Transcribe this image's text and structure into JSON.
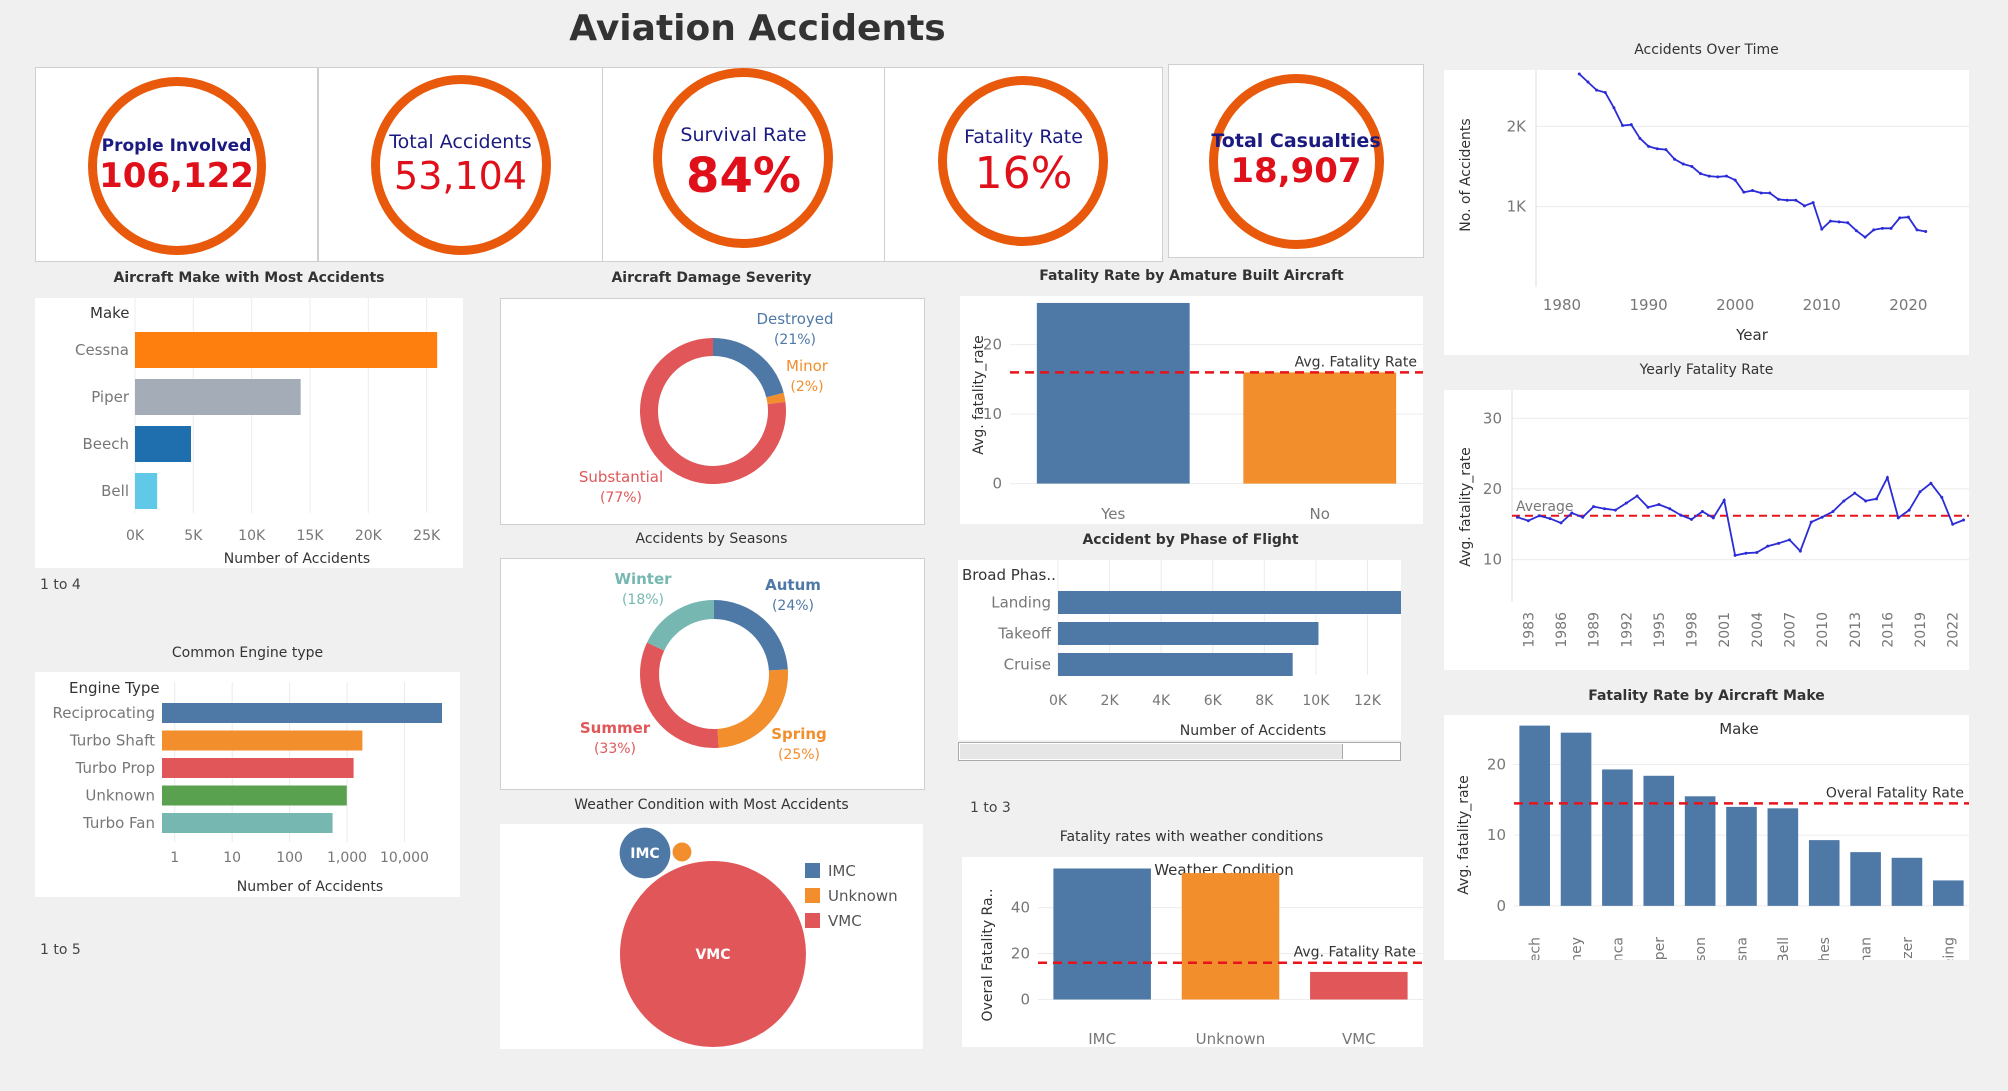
{
  "page_title": "Aviation Accidents",
  "kpis": [
    {
      "label": "Prople Involved",
      "value": "106,122"
    },
    {
      "label": "Total Accidents",
      "value": "53,104"
    },
    {
      "label": "Survival Rate",
      "value": "84%"
    },
    {
      "label": "Fatality Rate",
      "value": "16%"
    },
    {
      "label": "Total Casualties",
      "value": "18,907"
    }
  ],
  "pagers": {
    "make": "1 to 4",
    "engine": "1 to 5",
    "phase": "1 to 3"
  },
  "colors": {
    "kpi_ring": "#e8590c",
    "kpi_value": "#e0101a",
    "kpi_label": "#1a1a80",
    "bar_blue": "#4e79a7",
    "bar_orange": "#f28e2b",
    "ref_line": "#e8141c"
  },
  "chart_data": [
    {
      "id": "make",
      "type": "bar",
      "orientation": "horizontal",
      "title": "Aircraft Make with Most Accidents",
      "header": "Make",
      "xlabel": "Number of Accidents",
      "categories": [
        "Cessna",
        "Piper",
        "Beech",
        "Bell"
      ],
      "values": [
        25900,
        14200,
        4800,
        1900
      ],
      "colors": [
        "#ff7f0e",
        "#a4acb8",
        "#1f6ead",
        "#62c8e8"
      ],
      "xlim": [
        0,
        27000
      ],
      "xticks": [
        0,
        5000,
        10000,
        15000,
        20000,
        25000
      ],
      "xtick_labels": [
        "0K",
        "5K",
        "10K",
        "15K",
        "20K",
        "25K"
      ]
    },
    {
      "id": "damage",
      "type": "pie",
      "subtype": "donut",
      "title": "Aircraft Damage Severity",
      "slices": [
        {
          "label": "Destroyed",
          "pct_label": "(21%)",
          "value": 21,
          "color": "#4e79a7"
        },
        {
          "label": "Minor",
          "pct_label": "(2%)",
          "value": 2,
          "color": "#f28e2b"
        },
        {
          "label": "Substantial",
          "pct_label": "(77%)",
          "value": 77,
          "color": "#e15759"
        }
      ]
    },
    {
      "id": "amateur",
      "type": "bar",
      "title": "Fatality Rate by Amature Built Aircraft",
      "ylabel": "Avg. fatality_rate",
      "categories": [
        "Yes",
        "No"
      ],
      "values": [
        26,
        16
      ],
      "colors": [
        "#4e79a7",
        "#f28e2b"
      ],
      "ylim": [
        -1.5,
        27
      ],
      "yticks": [
        0,
        10,
        20
      ],
      "reference_line": {
        "label": "Avg.  Fatality Rate",
        "value": 16
      }
    },
    {
      "id": "time",
      "type": "line",
      "title": "Accidents Over Time",
      "xlabel": "Year",
      "ylabel": "No. of Accidents",
      "color": "#2c2cd6",
      "x": [
        1982,
        1983,
        1984,
        1985,
        1986,
        1987,
        1988,
        1989,
        1990,
        1991,
        1992,
        1993,
        1994,
        1995,
        1996,
        1997,
        1998,
        1999,
        2000,
        2001,
        2002,
        2003,
        2004,
        2005,
        2006,
        2007,
        2008,
        2009,
        2010,
        2011,
        2012,
        2013,
        2014,
        2015,
        2016,
        2017,
        2018,
        2019,
        2020,
        2021,
        2022
      ],
      "values": [
        2650,
        2550,
        2450,
        2420,
        2230,
        2010,
        2020,
        1850,
        1750,
        1720,
        1710,
        1590,
        1530,
        1500,
        1410,
        1380,
        1370,
        1380,
        1330,
        1180,
        1200,
        1170,
        1170,
        1090,
        1080,
        1080,
        1010,
        1050,
        720,
        820,
        810,
        800,
        700,
        620,
        710,
        730,
        730,
        860,
        870,
        710,
        690
      ],
      "xlim": [
        1977,
        2027
      ],
      "ylim": [
        0,
        2700
      ],
      "xticks": [
        1980,
        1990,
        2000,
        2010,
        2020
      ],
      "yticks": [
        1000,
        2000
      ],
      "ytick_labels": [
        "1K",
        "2K"
      ]
    },
    {
      "id": "yearly",
      "type": "line",
      "title": "Yearly Fatality Rate",
      "ylabel": "Avg. fatality_rate",
      "color": "#2c2cd6",
      "x": [
        1982,
        1983,
        1984,
        1985,
        1986,
        1987,
        1988,
        1989,
        1990,
        1991,
        1992,
        1993,
        1994,
        1995,
        1996,
        1997,
        1998,
        1999,
        2000,
        2001,
        2002,
        2003,
        2004,
        2005,
        2006,
        2007,
        2008,
        2009,
        2010,
        2011,
        2012,
        2013,
        2014,
        2015,
        2016,
        2017,
        2018,
        2019,
        2020,
        2021,
        2022,
        2023
      ],
      "values": [
        16,
        15.5,
        16.2,
        15.8,
        15.2,
        16.6,
        16,
        17.5,
        17.2,
        17,
        18,
        19,
        17.4,
        17.8,
        17.2,
        16.3,
        15.7,
        16.8,
        15.9,
        18.4,
        10.6,
        10.9,
        11,
        11.9,
        12.3,
        12.8,
        11.2,
        15.3,
        16,
        16.8,
        18.3,
        19.4,
        18.3,
        18.6,
        21.6,
        15.9,
        17,
        19.6,
        20.8,
        18.8,
        15,
        15.6
      ],
      "xlim": [
        1981.5,
        2023.5
      ],
      "ylim": [
        4,
        34
      ],
      "xticks": [
        1983,
        1986,
        1989,
        1992,
        1995,
        1998,
        2001,
        2004,
        2007,
        2010,
        2013,
        2016,
        2019,
        2022
      ],
      "yticks": [
        10,
        20,
        30
      ],
      "reference_line": {
        "label": "Average",
        "value": 16.2
      }
    },
    {
      "id": "seasons",
      "type": "pie",
      "subtype": "donut",
      "title": "Accidents by Seasons",
      "slices": [
        {
          "label": "Autum",
          "pct_label": "(24%)",
          "value": 24,
          "color": "#4e79a7"
        },
        {
          "label": "Spring",
          "pct_label": "(25%)",
          "value": 25,
          "color": "#f28e2b"
        },
        {
          "label": "Summer",
          "pct_label": "(33%)",
          "value": 33,
          "color": "#e15759"
        },
        {
          "label": "Winter",
          "pct_label": "(18%)",
          "value": 18,
          "color": "#76b7b2"
        }
      ]
    },
    {
      "id": "phase",
      "type": "bar",
      "orientation": "horizontal",
      "title": "Accident by Phase of Flight",
      "header": "Broad Phas..",
      "xlabel": "Number of Accidents",
      "categories": [
        "Landing",
        "Takeoff",
        "Cruise"
      ],
      "values": [
        13300,
        10100,
        9100
      ],
      "color": "#4e79a7",
      "xlim": [
        0,
        13300
      ],
      "xticks": [
        0,
        2000,
        4000,
        6000,
        8000,
        10000,
        12000
      ],
      "xtick_labels": [
        "0K",
        "2K",
        "4K",
        "6K",
        "8K",
        "10K",
        "12K"
      ]
    },
    {
      "id": "engine",
      "type": "bar",
      "orientation": "horizontal",
      "scale": "log",
      "title": "Common Engine type",
      "header": "Engine Type",
      "xlabel": "Number of Accidents",
      "categories": [
        "Reciprocating",
        "Turbo Shaft",
        "Turbo Prop",
        "Unknown",
        "Turbo Fan"
      ],
      "values": [
        45000,
        1850,
        1300,
        990,
        560
      ],
      "colors": [
        "#4e79a7",
        "#f28e2b",
        "#e15759",
        "#59a14f",
        "#76b7b2"
      ],
      "xlim": [
        0.6,
        55000
      ],
      "xticks": [
        1,
        10,
        100,
        1000,
        10000
      ],
      "xtick_labels": [
        "1",
        "10",
        "100",
        "1,000",
        "10,000"
      ]
    },
    {
      "id": "weather_bubble",
      "type": "scatter",
      "subtype": "bubble",
      "title": "Weather Condition with Most Accidents",
      "series": [
        {
          "name": "IMC",
          "value": 3.6,
          "color": "#4e79a7",
          "label": "IMC"
        },
        {
          "name": "Unknown",
          "value": 0.5,
          "color": "#f28e2b",
          "label": ""
        },
        {
          "name": "VMC",
          "value": 48.5,
          "color": "#e15759",
          "label": "VMC"
        }
      ],
      "legend": [
        "IMC",
        "Unknown",
        "VMC"
      ]
    },
    {
      "id": "weather_rate",
      "type": "bar",
      "title": "Fatality rates with weather conditions",
      "header": "Weather Condition",
      "ylabel": "Overal Fatality Ra..",
      "categories": [
        "IMC",
        "Unknown",
        "VMC"
      ],
      "values": [
        57,
        55,
        12
      ],
      "colors": [
        "#4e79a7",
        "#f28e2b",
        "#e15759"
      ],
      "ylim": [
        -5,
        62
      ],
      "yticks": [
        0,
        20,
        40
      ],
      "reference_line": {
        "label": "Avg. Fatality Rate",
        "value": 16
      }
    },
    {
      "id": "makerate",
      "type": "bar",
      "title": "Fatality Rate by Aircraft Make",
      "header": "Make",
      "ylabel": "Avg. fatality_rate",
      "categories": [
        "Beech",
        "Mooney",
        "Bellanca",
        "Piper",
        "Robinson",
        "Cessna",
        "Bell",
        "Hughes",
        "Grumman",
        "Schweizer",
        "Boeing"
      ],
      "values": [
        25.5,
        24.5,
        19.3,
        18.4,
        15.5,
        14,
        13.8,
        9.3,
        7.6,
        6.8,
        3.6
      ],
      "color": "#4e79a7",
      "ylim": [
        -2,
        27
      ],
      "yticks": [
        0,
        10,
        20
      ],
      "reference_line": {
        "label": "Overal Fatality Rate",
        "value": 14.5
      }
    }
  ]
}
